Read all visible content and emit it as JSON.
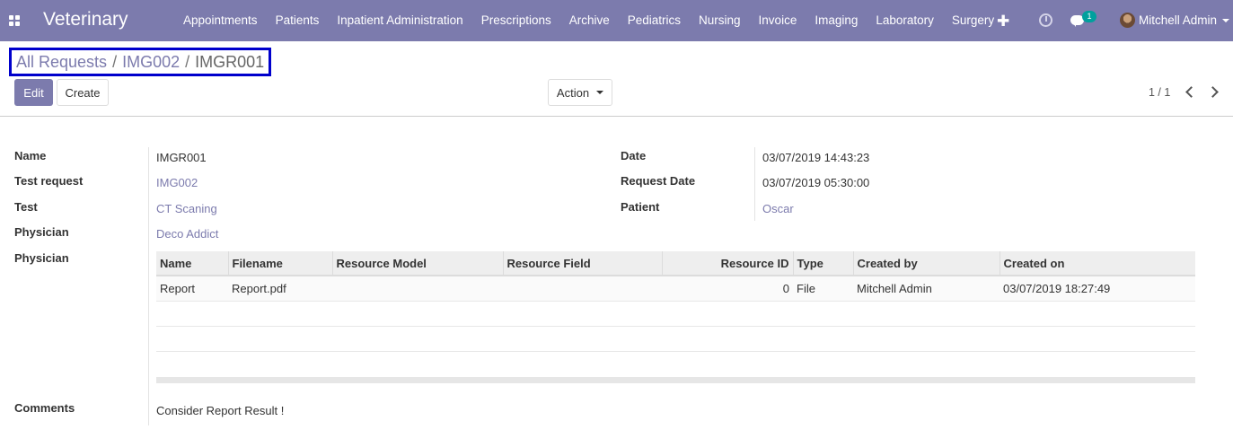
{
  "navbar": {
    "brand": "Veterinary",
    "menu": [
      "Appointments",
      "Patients",
      "Inpatient Administration",
      "Prescriptions",
      "Archive",
      "Pediatrics",
      "Nursing",
      "Invoice",
      "Imaging",
      "Laboratory",
      "Surgery"
    ],
    "chat_count": "1",
    "user": "Mitchell Admin",
    "icons": [
      "apps-icon",
      "plus-icon",
      "clock-icon",
      "chat-icon",
      "avatar"
    ]
  },
  "breadcrumb": {
    "root": "All Requests",
    "parent": "IMG002",
    "current": "IMGR001"
  },
  "toolbar": {
    "edit": "Edit",
    "create": "Create",
    "action": "Action"
  },
  "pager": "1 / 1",
  "form": {
    "name_label": "Name",
    "name": "IMGR001",
    "test_request_label": "Test request",
    "test_request": "IMG002",
    "test_label": "Test",
    "test": "CT Scaning",
    "physician_label": "Physician",
    "physician": "Deco Addict",
    "physician2_label": "Physician",
    "date_label": "Date",
    "date": "03/07/2019 14:43:23",
    "request_date_label": "Request Date",
    "request_date": "03/07/2019 05:30:00",
    "patient_label": "Patient",
    "patient": "Oscar",
    "comments_label": "Comments",
    "comments": "Consider Report Result !"
  },
  "attachments": {
    "columns": [
      "Name",
      "Filename",
      "Resource Model",
      "Resource Field",
      "Resource ID",
      "Type",
      "Created by",
      "Created on"
    ],
    "rows": [
      [
        "Report",
        "Report.pdf",
        "",
        "",
        "0",
        "File",
        "Mitchell Admin",
        "03/07/2019 18:27:49"
      ]
    ]
  },
  "colors": {
    "primary": "#7c7bad",
    "badge": "#00a09d",
    "highlight_border": "#0000cc"
  }
}
